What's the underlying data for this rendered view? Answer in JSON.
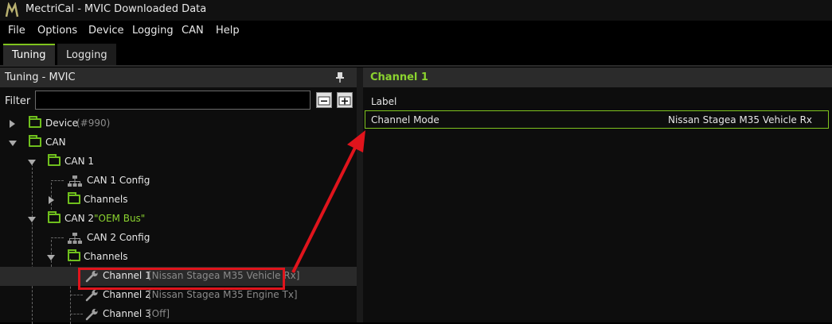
{
  "app": {
    "title": "MectriCal - MVIC Downloaded Data"
  },
  "menu": [
    "File",
    "Options",
    "Device",
    "Logging",
    "CAN",
    "Help"
  ],
  "tabs": [
    "Tuning",
    "Logging"
  ],
  "left_panel": {
    "title": "Tuning - MVIC",
    "filter_label": "Filter",
    "filter_value": "",
    "tree": {
      "device": {
        "label": "Device",
        "suffix": "(#990)"
      },
      "can": {
        "label": "CAN"
      },
      "can1": {
        "label": "CAN 1"
      },
      "can1_config": {
        "label": "CAN 1 Config"
      },
      "can1_channels": {
        "label": "Channels"
      },
      "can2": {
        "label": "CAN 2",
        "suffix": "\"OEM Bus\""
      },
      "can2_config": {
        "label": "CAN 2 Config"
      },
      "can2_channels": {
        "label": "Channels"
      },
      "channel1": {
        "label": "Channel 1",
        "suffix": "[Nissan Stagea M35 Vehicle Rx]"
      },
      "channel2": {
        "label": "Channel 2",
        "suffix": "[Nissan Stagea M35 Engine Tx]"
      },
      "channel3": {
        "label": "Channel 3",
        "suffix": "[Off]"
      }
    }
  },
  "right_panel": {
    "title": "Channel 1",
    "properties": [
      {
        "name": "Label",
        "value": ""
      },
      {
        "name": "Channel Mode",
        "value": "Nissan Stagea M35 Vehicle Rx"
      }
    ]
  },
  "colors": {
    "accent": "#8bd32f",
    "annotation": "#e0141c"
  }
}
